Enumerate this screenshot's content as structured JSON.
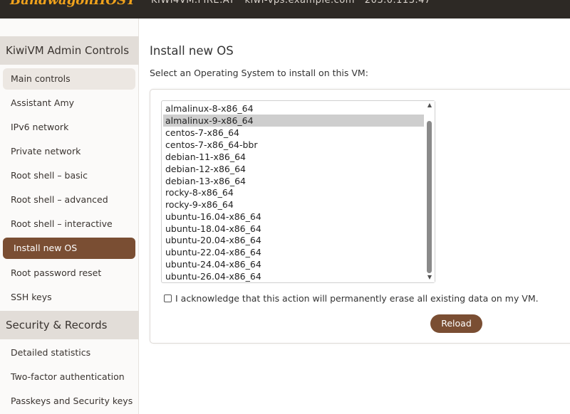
{
  "header": {
    "brand": "BandwagonHOST",
    "host_info": "KIWI4VM.FIRE.AT · kiwi-vps.example.com · 203.0.113.47"
  },
  "sidebar": {
    "section1_title": "KiwiVM Admin Controls",
    "section1_items": [
      {
        "label": "Main controls"
      },
      {
        "label": "Assistant Amy"
      },
      {
        "label": "IPv6 network"
      },
      {
        "label": "Private network"
      },
      {
        "label": "Root shell – basic"
      },
      {
        "label": "Root shell – advanced"
      },
      {
        "label": "Root shell – interactive"
      },
      {
        "label": "Install new OS"
      },
      {
        "label": "Root password reset"
      },
      {
        "label": "SSH keys"
      }
    ],
    "section2_title": "Security & Records",
    "section2_items": [
      {
        "label": "Detailed statistics"
      },
      {
        "label": "Two-factor authentication"
      },
      {
        "label": "Passkeys and Security keys"
      }
    ]
  },
  "main": {
    "title": "Install new OS",
    "subtitle": "Select an Operating System to install on this VM:",
    "os_options": [
      "almalinux-8-x86_64",
      "almalinux-9-x86_64",
      "centos-7-x86_64",
      "centos-7-x86_64-bbr",
      "debian-11-x86_64",
      "debian-12-x86_64",
      "debian-13-x86_64",
      "rocky-8-x86_64",
      "rocky-9-x86_64",
      "ubuntu-16.04-x86_64",
      "ubuntu-18.04-x86_64",
      "ubuntu-20.04-x86_64",
      "ubuntu-22.04-x86_64",
      "ubuntu-24.04-x86_64",
      "ubuntu-26.04-x86_64"
    ],
    "selected_option": "almalinux-9-x86_64",
    "acknowledge_label": "I acknowledge that this action will permanently erase all existing data on my VM.",
    "acknowledge_checked": false,
    "reload_label": "Reload"
  },
  "icons": {
    "scroll_up": "scroll-up-arrow-icon",
    "scroll_down": "scroll-down-arrow-icon"
  },
  "colors": {
    "accent": "#7a4e33",
    "header_bg": "#2d2925",
    "brand": "#f0a21c",
    "section_header_bg": "#e2ddd8",
    "selected_option_bg": "#cecece"
  }
}
